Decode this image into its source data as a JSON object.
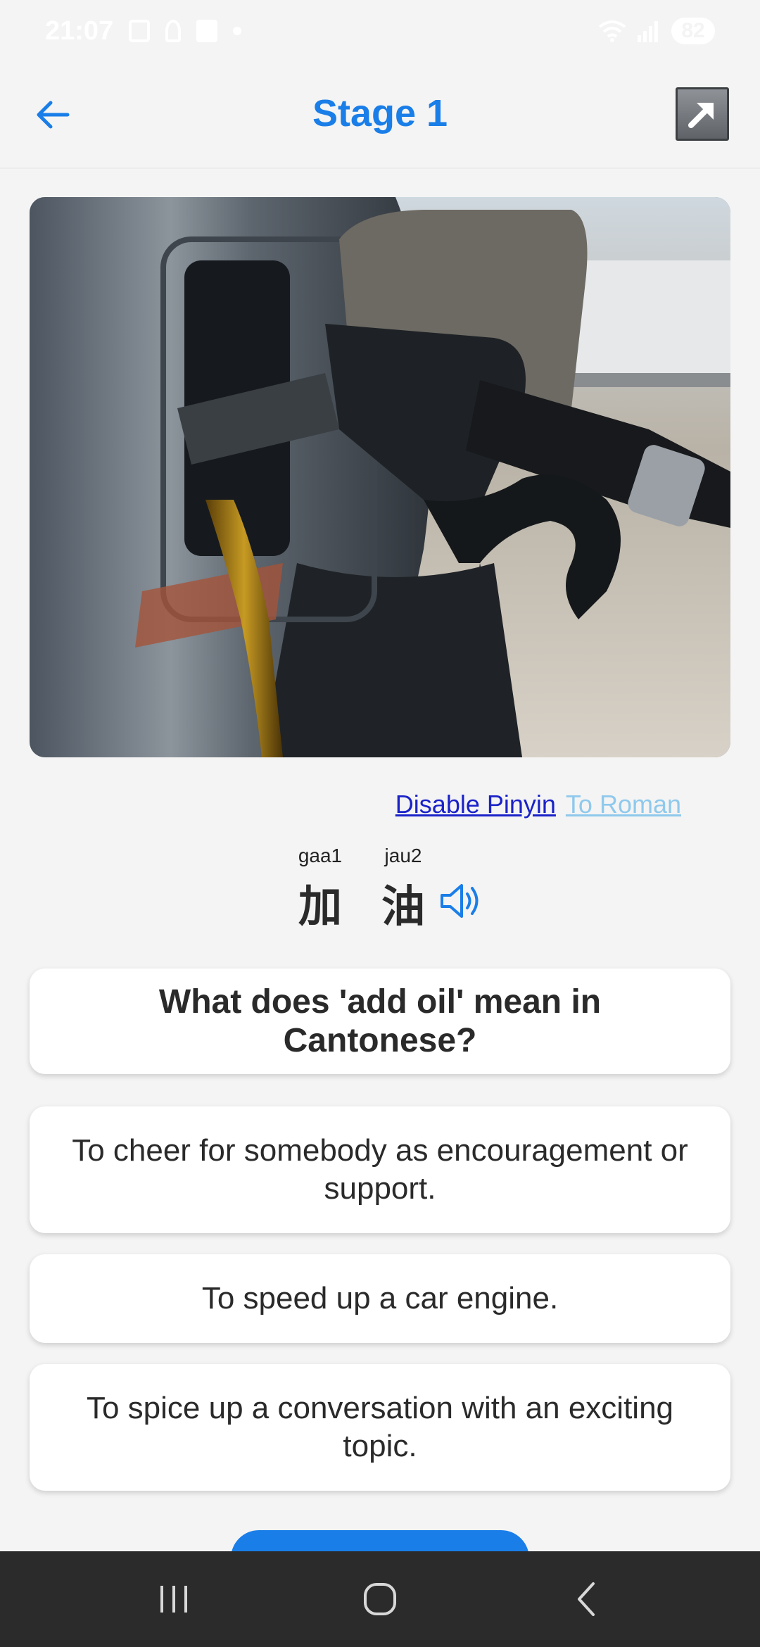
{
  "status_bar": {
    "time": "21:07",
    "battery": "82"
  },
  "header": {
    "title": "Stage 1"
  },
  "photo": {
    "description_icon": "fuel-pump-nozzle-image"
  },
  "toggles": {
    "disable_pinyin": "Disable Pinyin",
    "to_roman": "To Roman"
  },
  "word": {
    "characters": [
      {
        "jyutping": "gaa1",
        "hanzi": "加"
      },
      {
        "jyutping": "jau2",
        "hanzi": "油"
      }
    ]
  },
  "question": {
    "text": "What does 'add oil' mean in Cantonese?"
  },
  "options": [
    {
      "text": "To cheer for somebody as encouragement or support."
    },
    {
      "text": "To speed up a car engine."
    },
    {
      "text": "To spice up a conversation with an exciting topic."
    }
  ],
  "colors": {
    "accent": "#1a7ee8",
    "link_active": "#1a22c8",
    "link_inactive": "#8fc9ec",
    "background": "#f4f4f4",
    "navbar": "#2b2b2b"
  }
}
